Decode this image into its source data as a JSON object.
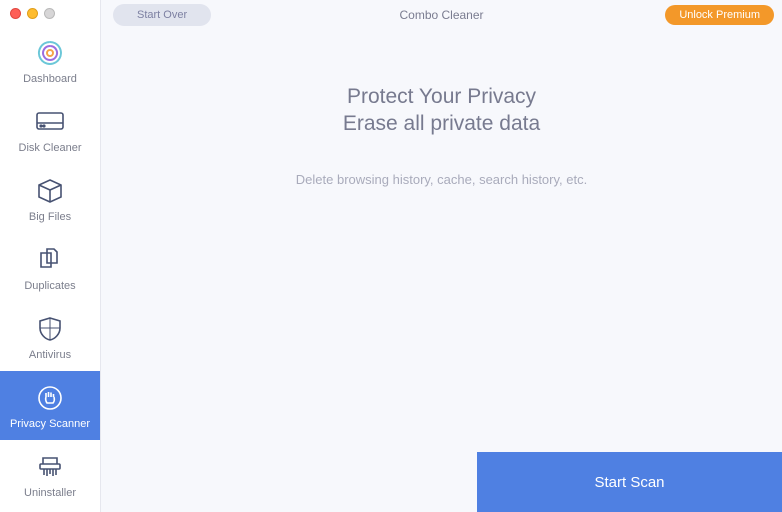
{
  "app_title": "Combo Cleaner",
  "topbar": {
    "start_over": "Start Over",
    "unlock": "Unlock Premium"
  },
  "sidebar": {
    "items": [
      {
        "label": "Dashboard"
      },
      {
        "label": "Disk Cleaner"
      },
      {
        "label": "Big Files"
      },
      {
        "label": "Duplicates"
      },
      {
        "label": "Antivirus"
      },
      {
        "label": "Privacy Scanner"
      },
      {
        "label": "Uninstaller"
      }
    ]
  },
  "content": {
    "headline1": "Protect Your Privacy",
    "headline2": "Erase all private data",
    "sub": "Delete browsing history, cache, search history, etc."
  },
  "footer": {
    "start_scan": "Start Scan"
  }
}
